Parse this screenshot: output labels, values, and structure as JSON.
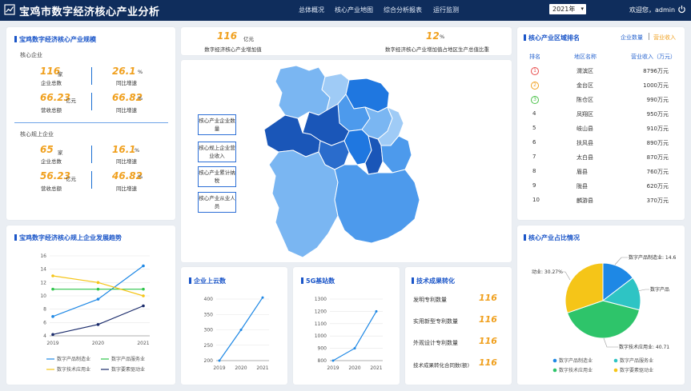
{
  "header": {
    "title": "宝鸡市数字经济核心产业分析",
    "nav": [
      "总体概况",
      "核心产业地图",
      "综合分析报表",
      "运行监测"
    ],
    "year": "2021年",
    "welcome": "欢迎您，admin"
  },
  "scale": {
    "title": "宝鸡数字经济核心产业规模",
    "groups": [
      {
        "title": "核心企业",
        "count": "116",
        "count_unit": "家",
        "count_label": "企业总数",
        "rate1": "26.1",
        "rate1_unit": "%",
        "rate1_label": "同比增速",
        "revenue": "66.23",
        "revenue_unit": "亿元",
        "revenue_label": "营收总额",
        "rate2": "66.82",
        "rate2_unit": "%",
        "rate2_label": "同比增速"
      },
      {
        "title": "核心规上企业",
        "count": "65",
        "count_unit": "家",
        "count_label": "企业总数",
        "rate1": "16.1",
        "rate1_unit": "%",
        "rate1_label": "同比增速",
        "revenue": "56.23",
        "revenue_unit": "亿元",
        "revenue_label": "营收总额",
        "rate2": "46.82",
        "rate2_unit": "%",
        "rate2_label": "同比增速"
      }
    ]
  },
  "kpi": {
    "added_value": "116",
    "added_value_unit": "亿元",
    "added_value_label": "数字经济核心产业增加值",
    "share": "12",
    "share_unit": "%",
    "share_label": "数字经济核心产业增加值占地区生产总值比重"
  },
  "map": {
    "buttons": [
      "核心产业企业数量",
      "核心规上企业营业收入",
      "核心产业累计纳税",
      "核心产业从业人员"
    ]
  },
  "ranking": {
    "title": "核心产业区域排名",
    "tabs": [
      "企业数量",
      "营业收入"
    ],
    "headers": [
      "排名",
      "地区名称",
      "营业收入（万元）"
    ],
    "rows": [
      {
        "rank": "1",
        "name": "渭滨区",
        "value": "8796万元"
      },
      {
        "rank": "2",
        "name": "金台区",
        "value": "1000万元"
      },
      {
        "rank": "3",
        "name": "陈仓区",
        "value": "990万元"
      },
      {
        "rank": "4",
        "name": "凤翔区",
        "value": "950万元"
      },
      {
        "rank": "5",
        "name": "岐山县",
        "value": "910万元"
      },
      {
        "rank": "6",
        "name": "扶风县",
        "value": "890万元"
      },
      {
        "rank": "7",
        "name": "太白县",
        "value": "870万元"
      },
      {
        "rank": "8",
        "name": "眉县",
        "value": "760万元"
      },
      {
        "rank": "9",
        "name": "陇县",
        "value": "620万元"
      },
      {
        "rank": "10",
        "name": "麟游县",
        "value": "370万元"
      }
    ],
    "medal_colors": [
      "#e84a4a",
      "#f0a01e",
      "#4cc24a"
    ]
  },
  "trend": {
    "title": "宝鸡数字经济核心规上企业发展趋势",
    "chart_data": {
      "type": "line",
      "x": [
        "2019",
        "2020",
        "2021"
      ],
      "ylim": [
        4,
        16
      ],
      "yticks": [
        4,
        6,
        8,
        10,
        12,
        14,
        16
      ],
      "series": [
        {
          "name": "数字产品制造业",
          "color": "#1e88e5",
          "values": [
            6.9,
            9.5,
            14.5
          ]
        },
        {
          "name": "数字产品服务业",
          "color": "#2ec44a",
          "values": [
            11,
            11,
            11
          ]
        },
        {
          "name": "数字技术应用业",
          "color": "#f5c518",
          "values": [
            13,
            12,
            10
          ]
        },
        {
          "name": "数字要素驱动业",
          "color": "#1a2b6b",
          "values": [
            4.2,
            5.7,
            8.5
          ]
        }
      ]
    }
  },
  "cloud": {
    "title": "企业上云数",
    "chart_data": {
      "type": "line",
      "x": [
        "2019",
        "2020",
        "2021"
      ],
      "ylim": [
        200,
        400
      ],
      "yticks": [
        200,
        250,
        300,
        350,
        400
      ],
      "series": [
        {
          "color": "#1e88e5",
          "values": [
            200,
            300,
            405
          ]
        }
      ]
    }
  },
  "base5g": {
    "title": "5G基站数",
    "chart_data": {
      "type": "line",
      "x": [
        "2019",
        "2020",
        "2021"
      ],
      "ylim": [
        800,
        1300
      ],
      "yticks": [
        800,
        900,
        1000,
        1100,
        1200,
        1300
      ],
      "series": [
        {
          "color": "#1e88e5",
          "values": [
            800,
            900,
            1200
          ]
        }
      ]
    }
  },
  "tech": {
    "title": "技术成果转化",
    "items": [
      {
        "label": "发明专利数量",
        "value": "116"
      },
      {
        "label": "实用新型专利数量",
        "value": "116"
      },
      {
        "label": "外观设计专利数量",
        "value": "116"
      },
      {
        "label": "技术成果转化合同数(额)",
        "value": "116"
      }
    ]
  },
  "share_pie": {
    "title": "核心产业占比情况",
    "chart_data": {
      "type": "pie",
      "slices": [
        {
          "name": "数字产品制造业",
          "value": 14.6,
          "color": "#1e88e5"
        },
        {
          "name": "数字产品服务业",
          "value": 14.4,
          "color": "#2ec4c4"
        },
        {
          "name": "数字技术应用业",
          "value": 40.71,
          "color": "#2ec46a"
        },
        {
          "name": "数字要素驱动业",
          "value": 30.27,
          "color": "#f5c518"
        }
      ],
      "labels": [
        "数字产品制造业: 14.6",
        "数字产品",
        "数字技术应用业: 40.71",
        "动业: 30.27%"
      ]
    }
  }
}
